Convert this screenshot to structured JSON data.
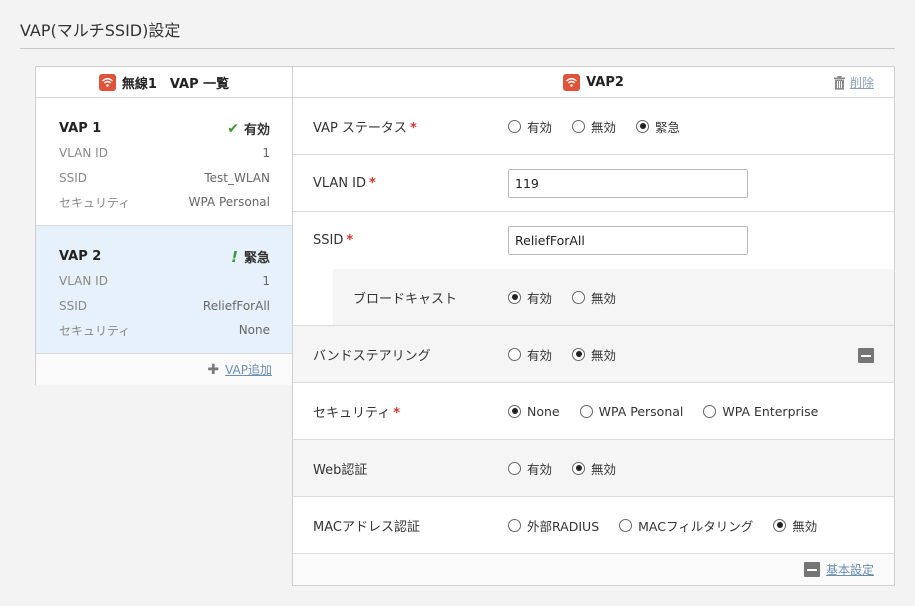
{
  "page": {
    "title": "VAP(マルチSSID)設定"
  },
  "colors": {
    "wifi_badge": "#e0533a",
    "required": "#d9342b",
    "selected_bg": "#e7f1fb",
    "link": "#6a8fb0"
  },
  "left_panel": {
    "title": "無線1　VAP 一覧",
    "vaps": [
      {
        "name": "VAP 1",
        "status_icon": "check-icon",
        "status": "有効",
        "rows": [
          {
            "label": "VLAN ID",
            "value": "1"
          },
          {
            "label": "SSID",
            "value": "Test_WLAN"
          },
          {
            "label": "セキュリティ",
            "value": "WPA Personal"
          }
        ]
      },
      {
        "name": "VAP 2",
        "status_icon": "exclamation-icon",
        "status": "緊急",
        "rows": [
          {
            "label": "VLAN ID",
            "value": "1"
          },
          {
            "label": "SSID",
            "value": "ReliefForAll"
          },
          {
            "label": "セキュリティ",
            "value": "None"
          }
        ]
      }
    ],
    "add_label": "VAP追加"
  },
  "right_panel": {
    "title": "VAP2",
    "delete_label": "削除",
    "vap_status": {
      "label": "VAP ステータス",
      "options": [
        "有効",
        "無効",
        "緊急"
      ],
      "selected": 2
    },
    "vlan_id": {
      "label": "VLAN ID",
      "value": "119"
    },
    "ssid": {
      "label": "SSID",
      "value": "ReliefForAll"
    },
    "broadcast": {
      "label": "ブロードキャスト",
      "options": [
        "有効",
        "無効"
      ],
      "selected": 0
    },
    "band_steering": {
      "label": "バンドステアリング",
      "options": [
        "有効",
        "無効"
      ],
      "selected": 1
    },
    "security": {
      "label": "セキュリティ",
      "options": [
        "None",
        "WPA Personal",
        "WPA Enterprise"
      ],
      "selected": 0
    },
    "web_auth": {
      "label": "Web認証",
      "options": [
        "有効",
        "無効"
      ],
      "selected": 1
    },
    "mac_auth": {
      "label": "MACアドレス認証",
      "options": [
        "外部RADIUS",
        "MACフィルタリング",
        "無効"
      ],
      "selected": 2
    },
    "basic_settings_label": "基本設定",
    "required_mark": "*"
  }
}
